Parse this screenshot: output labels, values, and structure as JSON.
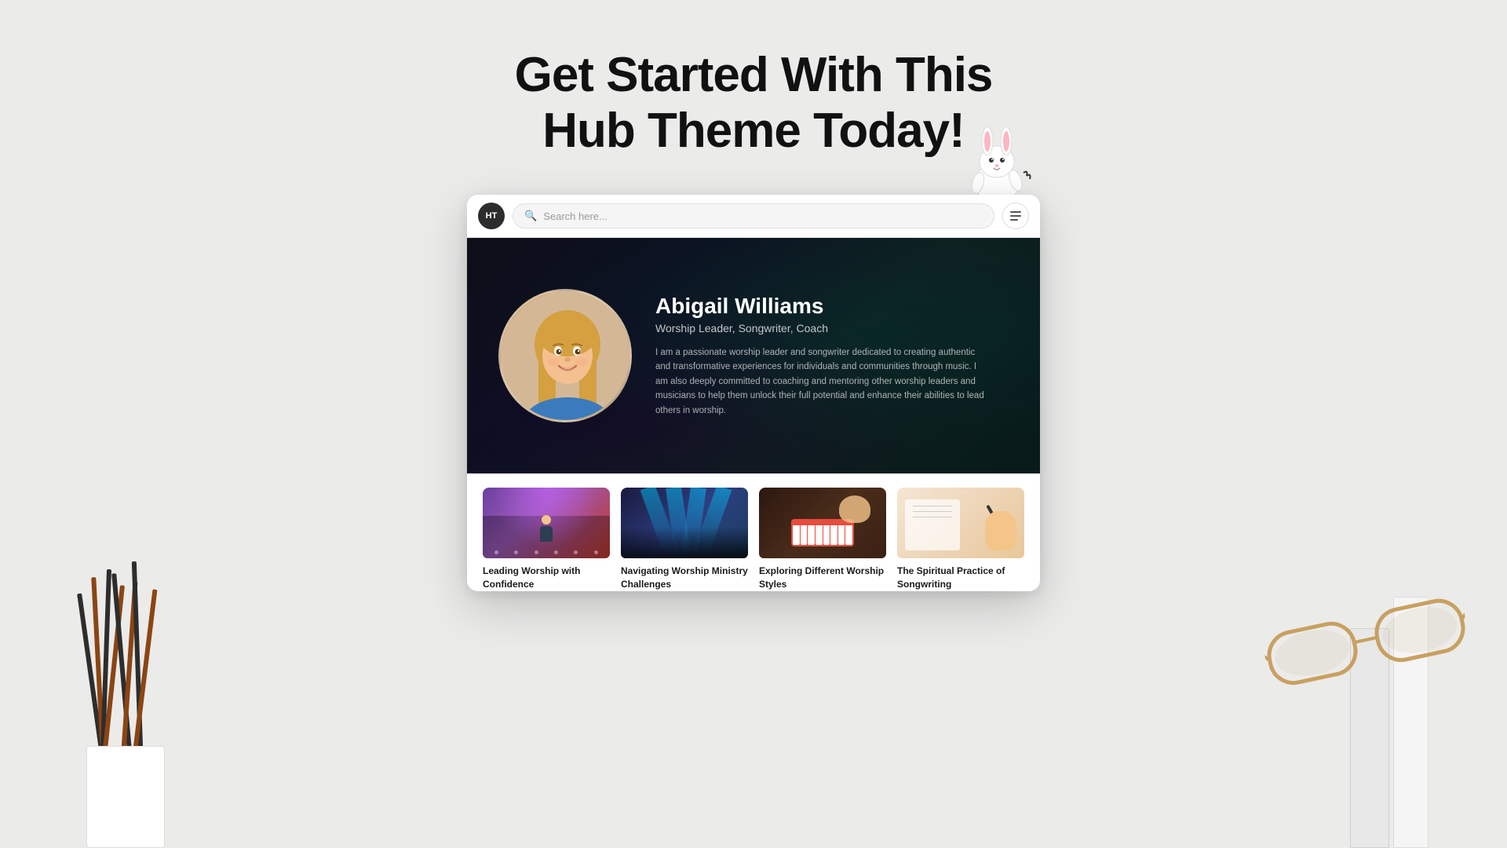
{
  "page": {
    "background_color": "#ebebea"
  },
  "heading": {
    "line1": "Get Started With This",
    "line2": "Hub Theme Today!"
  },
  "browser": {
    "logo_initials": "HT",
    "search_placeholder": "Search here...",
    "menu_label": "Menu"
  },
  "hero": {
    "name": "Abigail Williams",
    "title": "Worship Leader, Songwriter, Coach",
    "bio": "I am a passionate worship leader and songwriter dedicated to creating authentic and transformative experiences for individuals and communities through music. I am also deeply committed to coaching and mentoring other worship leaders and musicians to help them unlock their full potential and enhance their abilities to lead others in worship."
  },
  "cards": [
    {
      "id": 1,
      "title": "Leading Worship with Confidence",
      "image_alt": "Speaker on stage with purple lighting"
    },
    {
      "id": 2,
      "title": "Navigating Worship Ministry Challenges",
      "image_alt": "Concert crowd with blue lights"
    },
    {
      "id": 3,
      "title": "Exploring Different Worship Styles",
      "image_alt": "Red keyboard synthesizer"
    },
    {
      "id": 4,
      "title": "The Spiritual Practice of Songwriting",
      "image_alt": "Hand writing with pen"
    }
  ]
}
